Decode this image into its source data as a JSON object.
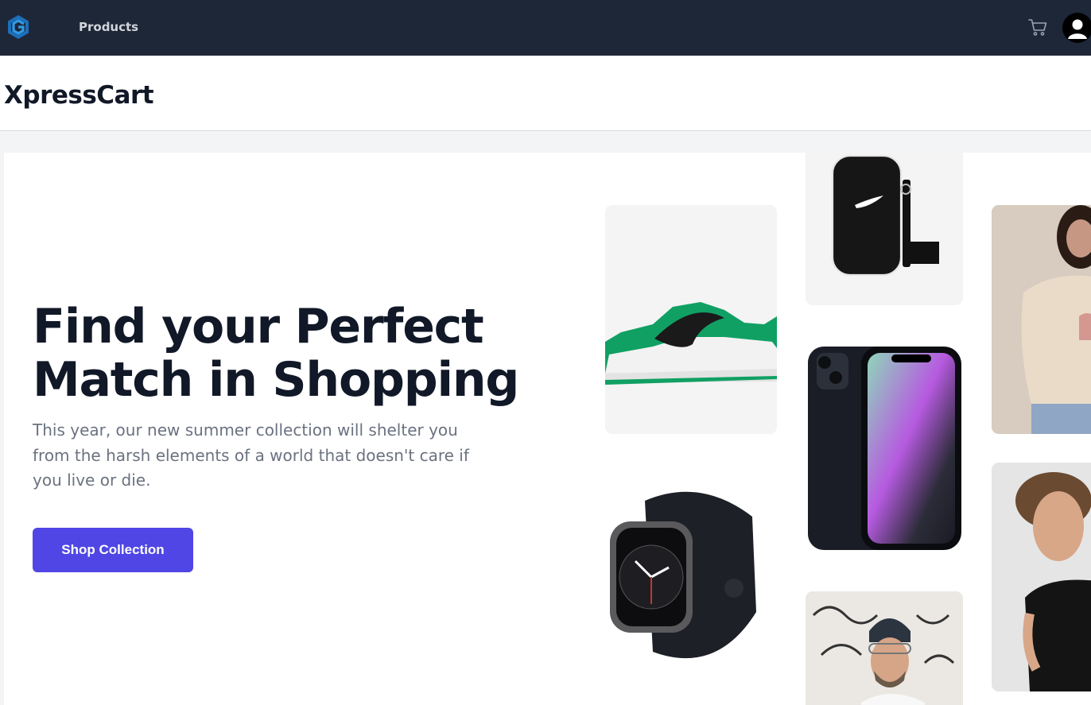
{
  "nav": {
    "logo_icon": "hexagon-logo-icon",
    "products_label": "Products",
    "cart_icon": "cart-icon",
    "avatar_icon": "user-avatar-icon"
  },
  "header": {
    "brand": "XpressCart"
  },
  "hero": {
    "headline_line1": "Find your Perfect",
    "headline_line2": "Match in Shopping",
    "subtext": "This year, our new summer collection will shelter you from the harsh elements of a world that doesn't care if you live or die.",
    "cta_label": "Shop Collection"
  },
  "products": [
    {
      "name": "green-sneaker-image"
    },
    {
      "name": "black-crossbody-bag-image"
    },
    {
      "name": "woman-tshirt-image"
    },
    {
      "name": "smartphone-image"
    },
    {
      "name": "smartwatch-image"
    },
    {
      "name": "man-black-tshirt-image"
    },
    {
      "name": "man-beanie-image"
    }
  ],
  "colors": {
    "nav_bg": "#1e2738",
    "accent": "#4f46e5",
    "heading": "#111827",
    "muted": "#6b7280"
  }
}
